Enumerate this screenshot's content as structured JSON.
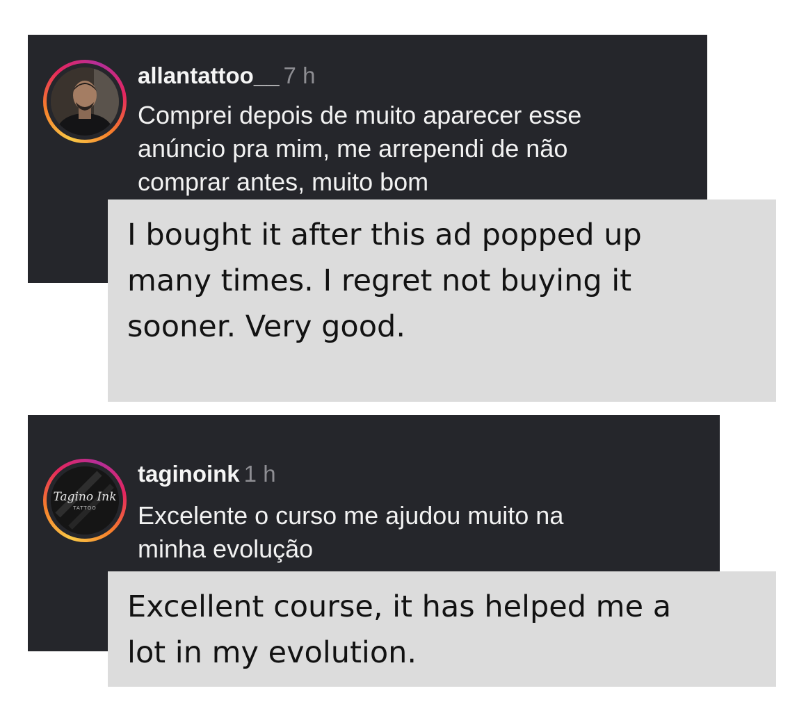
{
  "comments": [
    {
      "username": "allantattoo__",
      "timestamp": "7 h",
      "text_lines": [
        "Comprei depois de muito aparecer esse",
        "anúncio pra mim, me arrependi de não",
        "comprar antes, muito bom"
      ],
      "translation_lines": [
        "I bought it after this ad popped up",
        "many times. I regret not buying it",
        "sooner. Very good."
      ]
    },
    {
      "username": "taginoink",
      "timestamp": "1 h",
      "avatar_logo_text": "Tagino Ink",
      "avatar_logo_subtext": "TATTOO",
      "text_lines": [
        "Excelente o curso me ajudou muito na",
        "minha evolução"
      ],
      "translation_lines": [
        "Excellent course, it has helped me a",
        "lot in my evolution."
      ]
    }
  ],
  "colors": {
    "card_background": "#25262b",
    "translation_background": "#dcdcdc",
    "username": "#f5f5f5",
    "timestamp": "#8e8e93",
    "story_ring": [
      "#f9c846",
      "#f77f2b",
      "#e4265f",
      "#b42e9a"
    ]
  }
}
